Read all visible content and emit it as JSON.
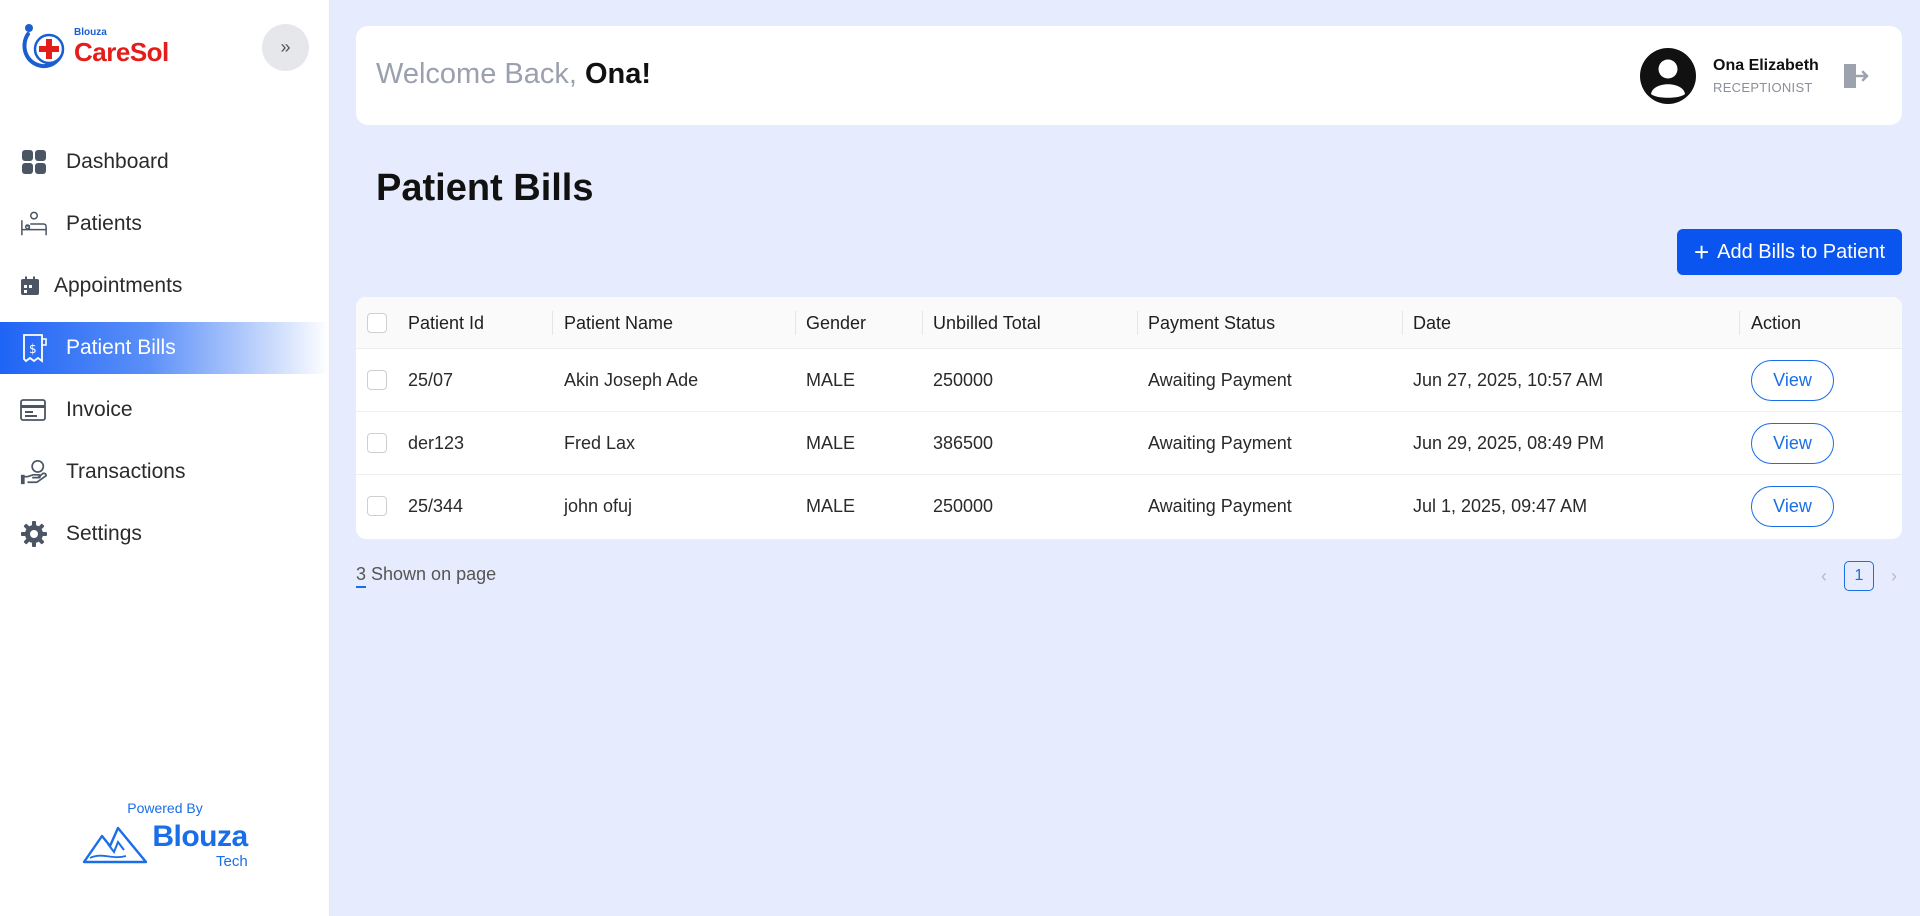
{
  "brand": {
    "small": "Blouza",
    "name": "CareSol"
  },
  "sidebar": {
    "items": [
      {
        "label": "Dashboard",
        "icon": "dashboard-icon"
      },
      {
        "label": "Patients",
        "icon": "patient-bed-icon"
      },
      {
        "label": "Appointments",
        "icon": "calendar-icon"
      },
      {
        "label": "Patient Bills",
        "icon": "bill-icon",
        "active": true
      },
      {
        "label": "Invoice",
        "icon": "invoice-icon"
      },
      {
        "label": "Transactions",
        "icon": "hand-coin-icon"
      },
      {
        "label": "Settings",
        "icon": "gear-icon"
      }
    ],
    "powered_by": "Powered By",
    "powered_name": "Blouza",
    "powered_sub": "Tech"
  },
  "header": {
    "welcome": "Welcome Back, ",
    "first_name": "Ona!",
    "user_name": "Ona Elizabeth",
    "user_role": "RECEPTIONIST"
  },
  "main": {
    "title": "Patient Bills",
    "add_button": "Add Bills to Patient"
  },
  "table": {
    "columns": [
      "Patient Id",
      "Patient Name",
      "Gender",
      "Unbilled Total",
      "Payment Status",
      "Date",
      "Action"
    ],
    "rows": [
      {
        "id": "25/07",
        "name": "Akin Joseph Ade",
        "gender": "MALE",
        "total": "250000",
        "status": "Awaiting Payment",
        "date": "Jun 27, 2025, 10:57 AM",
        "action": "View"
      },
      {
        "id": "der123",
        "name": "Fred Lax",
        "gender": "MALE",
        "total": "386500",
        "status": "Awaiting Payment",
        "date": "Jun 29, 2025, 08:49 PM",
        "action": "View"
      },
      {
        "id": "25/344",
        "name": "john ofuj",
        "gender": "MALE",
        "total": "250000",
        "status": "Awaiting Payment",
        "date": "Jul 1, 2025, 09:47 AM",
        "action": "View"
      }
    ]
  },
  "footer": {
    "shown_count": "3",
    "shown_text": " Shown on page",
    "page": "1",
    "prev": "‹",
    "next": "›"
  },
  "colors": {
    "accent": "#0a55ef",
    "brand_red": "#e31d1a",
    "brand_blue": "#1a6ee8",
    "background": "#e6ecfd"
  }
}
